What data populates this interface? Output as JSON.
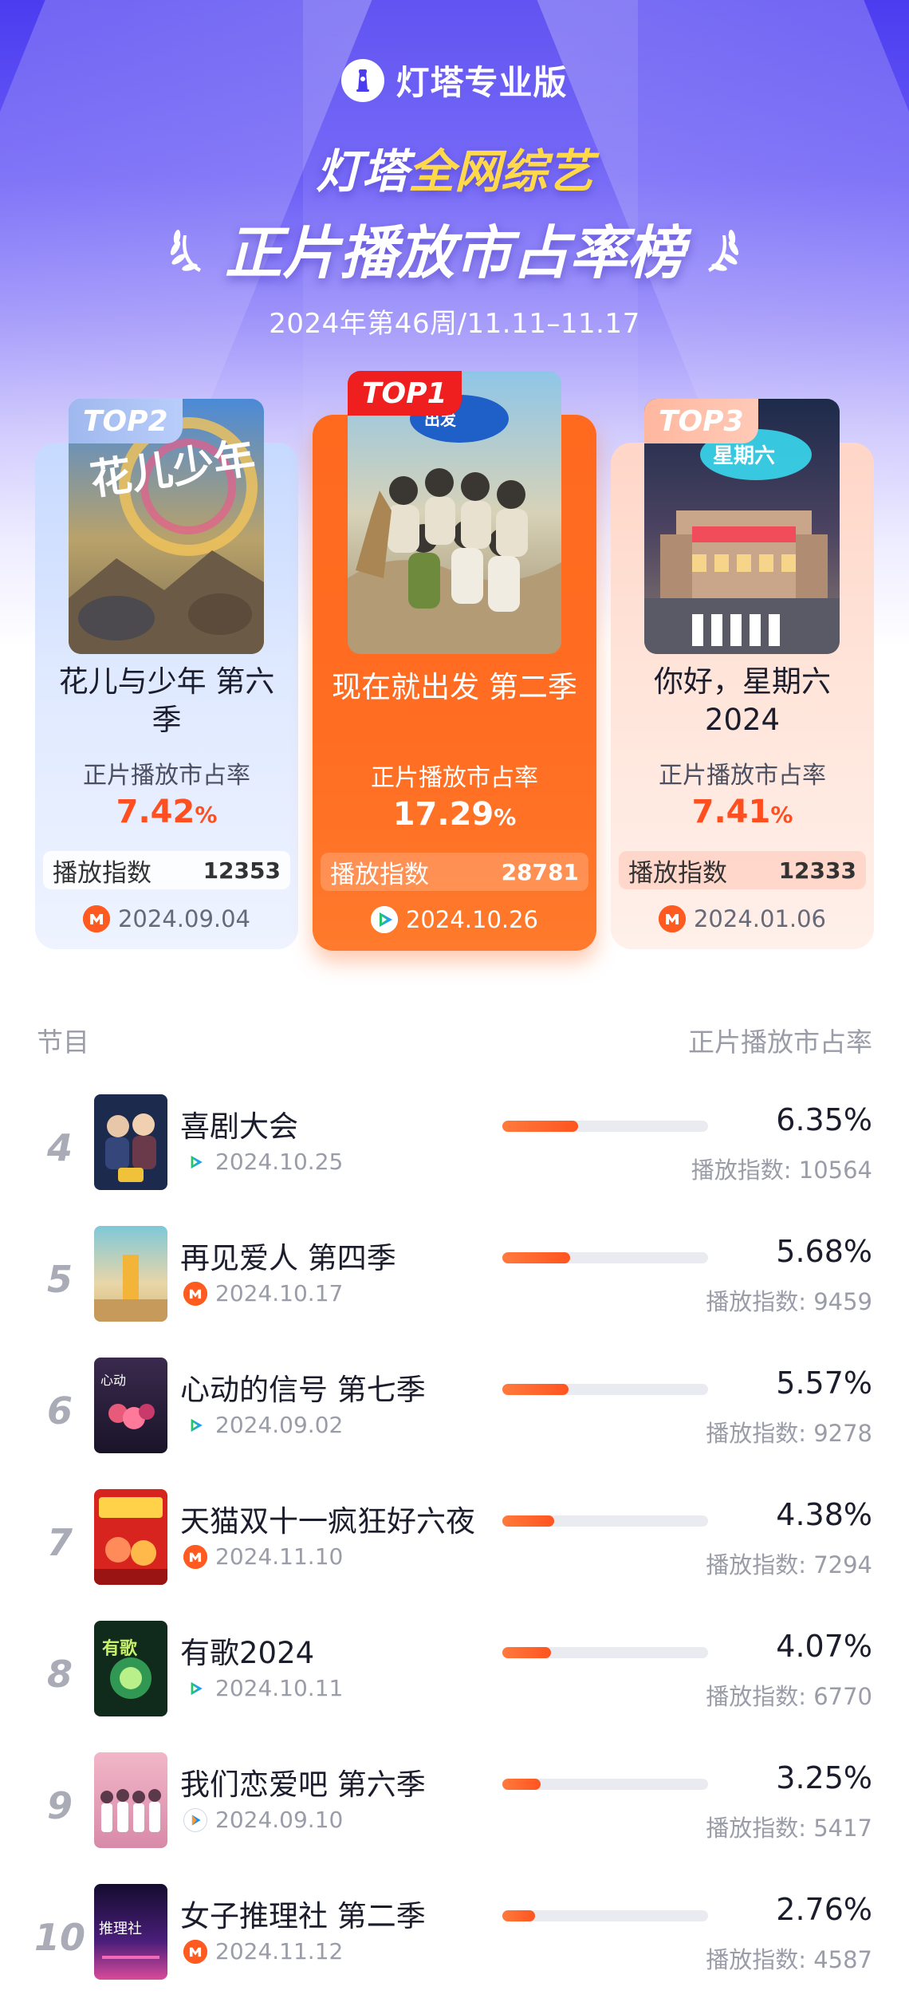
{
  "brand": {
    "name": "灯塔专业版",
    "icon": "lighthouse-icon"
  },
  "header": {
    "title_prefix": "灯塔",
    "title_accent": "全网综艺",
    "title_main": "正片播放市占率榜",
    "week": "2024年第46周/11.11–11.17"
  },
  "colors": {
    "accent_orange": "#ff5420",
    "top1_bg": "#ff6a1f",
    "top2_bg": "#dfe9ff",
    "top3_bg": "#ffe4d9",
    "hero_purple": "#4b3cf0"
  },
  "top": [
    {
      "tag": "TOP2",
      "title": "花儿与少年 第六季",
      "metric_label": "正片播放市占率",
      "share": "7.42",
      "pct": "%",
      "index_label": "播放指数",
      "index": "12353",
      "date": "2024.09.04",
      "platform": "mango-tv-icon"
    },
    {
      "tag": "TOP1",
      "title": "现在就出发 第二季",
      "metric_label": "正片播放市占率",
      "share": "17.29",
      "pct": "%",
      "index_label": "播放指数",
      "index": "28781",
      "date": "2024.10.26",
      "platform": "tencent-video-icon"
    },
    {
      "tag": "TOP3",
      "title": "你好，星期六 2024",
      "metric_label": "正片播放市占率",
      "share": "7.41",
      "pct": "%",
      "index_label": "播放指数",
      "index": "12333",
      "date": "2024.01.06",
      "platform": "mango-tv-icon"
    }
  ],
  "list_header": {
    "left": "节目",
    "right": "正片播放市占率"
  },
  "rows": [
    {
      "rank": "4",
      "name": "喜剧大会",
      "date": "2024.10.25",
      "platform": "tencent-video-icon",
      "share": "6.35%",
      "share_value": 6.35,
      "index_text": "播放指数: 10564"
    },
    {
      "rank": "5",
      "name": "再见爱人 第四季",
      "date": "2024.10.17",
      "platform": "mango-tv-icon",
      "share": "5.68%",
      "share_value": 5.68,
      "index_text": "播放指数: 9459"
    },
    {
      "rank": "6",
      "name": "心动的信号 第七季",
      "date": "2024.09.02",
      "platform": "tencent-video-icon",
      "share": "5.57%",
      "share_value": 5.57,
      "index_text": "播放指数: 9278"
    },
    {
      "rank": "7",
      "name": "天猫双十一疯狂好六夜",
      "date": "2024.11.10",
      "platform": "mango-tv-icon",
      "share": "4.38%",
      "share_value": 4.38,
      "index_text": "播放指数: 7294"
    },
    {
      "rank": "8",
      "name": "有歌2024",
      "date": "2024.10.11",
      "platform": "tencent-video-icon",
      "share": "4.07%",
      "share_value": 4.07,
      "index_text": "播放指数: 6770"
    },
    {
      "rank": "9",
      "name": "我们恋爱吧 第六季",
      "date": "2024.09.10",
      "platform": "youku-icon",
      "share": "3.25%",
      "share_value": 3.25,
      "index_text": "播放指数: 5417"
    },
    {
      "rank": "10",
      "name": "女子推理社 第二季",
      "date": "2024.11.12",
      "platform": "mango-tv-icon",
      "share": "2.76%",
      "share_value": 2.76,
      "index_text": "播放指数: 4587"
    }
  ]
}
